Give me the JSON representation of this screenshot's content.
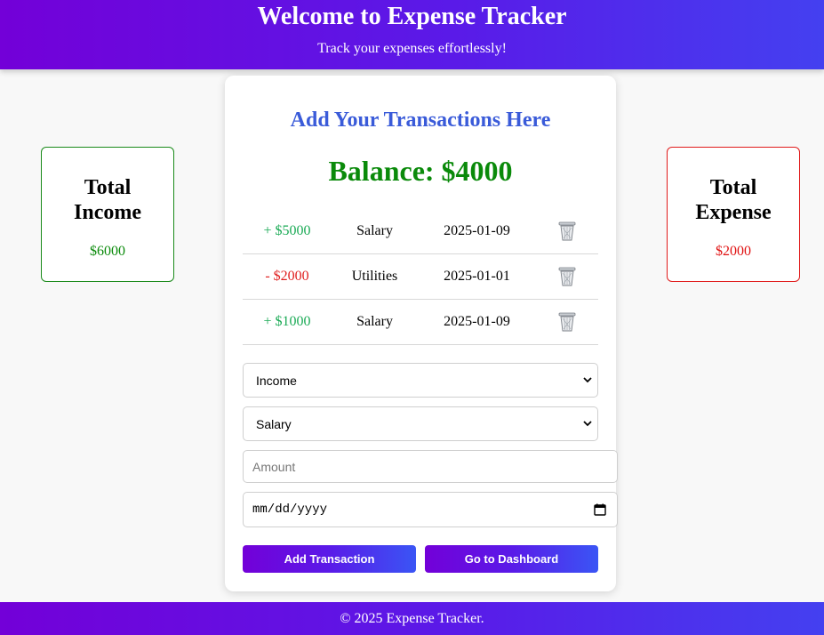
{
  "header": {
    "title": "Welcome to Expense Tracker",
    "subtitle": "Track your expenses effortlessly!"
  },
  "income_card": {
    "label": "Total Income",
    "value": "$6000",
    "color": "#0a8a0a"
  },
  "expense_card": {
    "label": "Total Expense",
    "value": "$2000",
    "color": "#e01010"
  },
  "main": {
    "title": "Add Your Transactions Here",
    "balance": "Balance: $4000",
    "transactions": [
      {
        "amount": "+ $5000",
        "category": "Salary",
        "date": "2025-01-09",
        "type": "income",
        "delete_icon": "trash-icon"
      },
      {
        "amount": "- $2000",
        "category": "Utilities",
        "date": "2025-01-01",
        "type": "expense",
        "delete_icon": "trash-icon"
      },
      {
        "amount": "+ $1000",
        "category": "Salary",
        "date": "2025-01-09",
        "type": "income",
        "delete_icon": "trash-icon"
      }
    ],
    "form": {
      "type_select": "Income",
      "category_select": "Salary",
      "amount_placeholder": "Amount",
      "date_placeholder": "mm/dd/yyyy"
    },
    "buttons": {
      "add": "Add Transaction",
      "dashboard": "Go to Dashboard"
    }
  },
  "footer": {
    "text": "© 2025 Expense Tracker."
  },
  "colors": {
    "gradient_start": "#7300d8",
    "gradient_end": "#4440f0",
    "title_blue": "#3a5bd9",
    "income_green": "#1aaa55",
    "expense_red": "#e02020"
  }
}
